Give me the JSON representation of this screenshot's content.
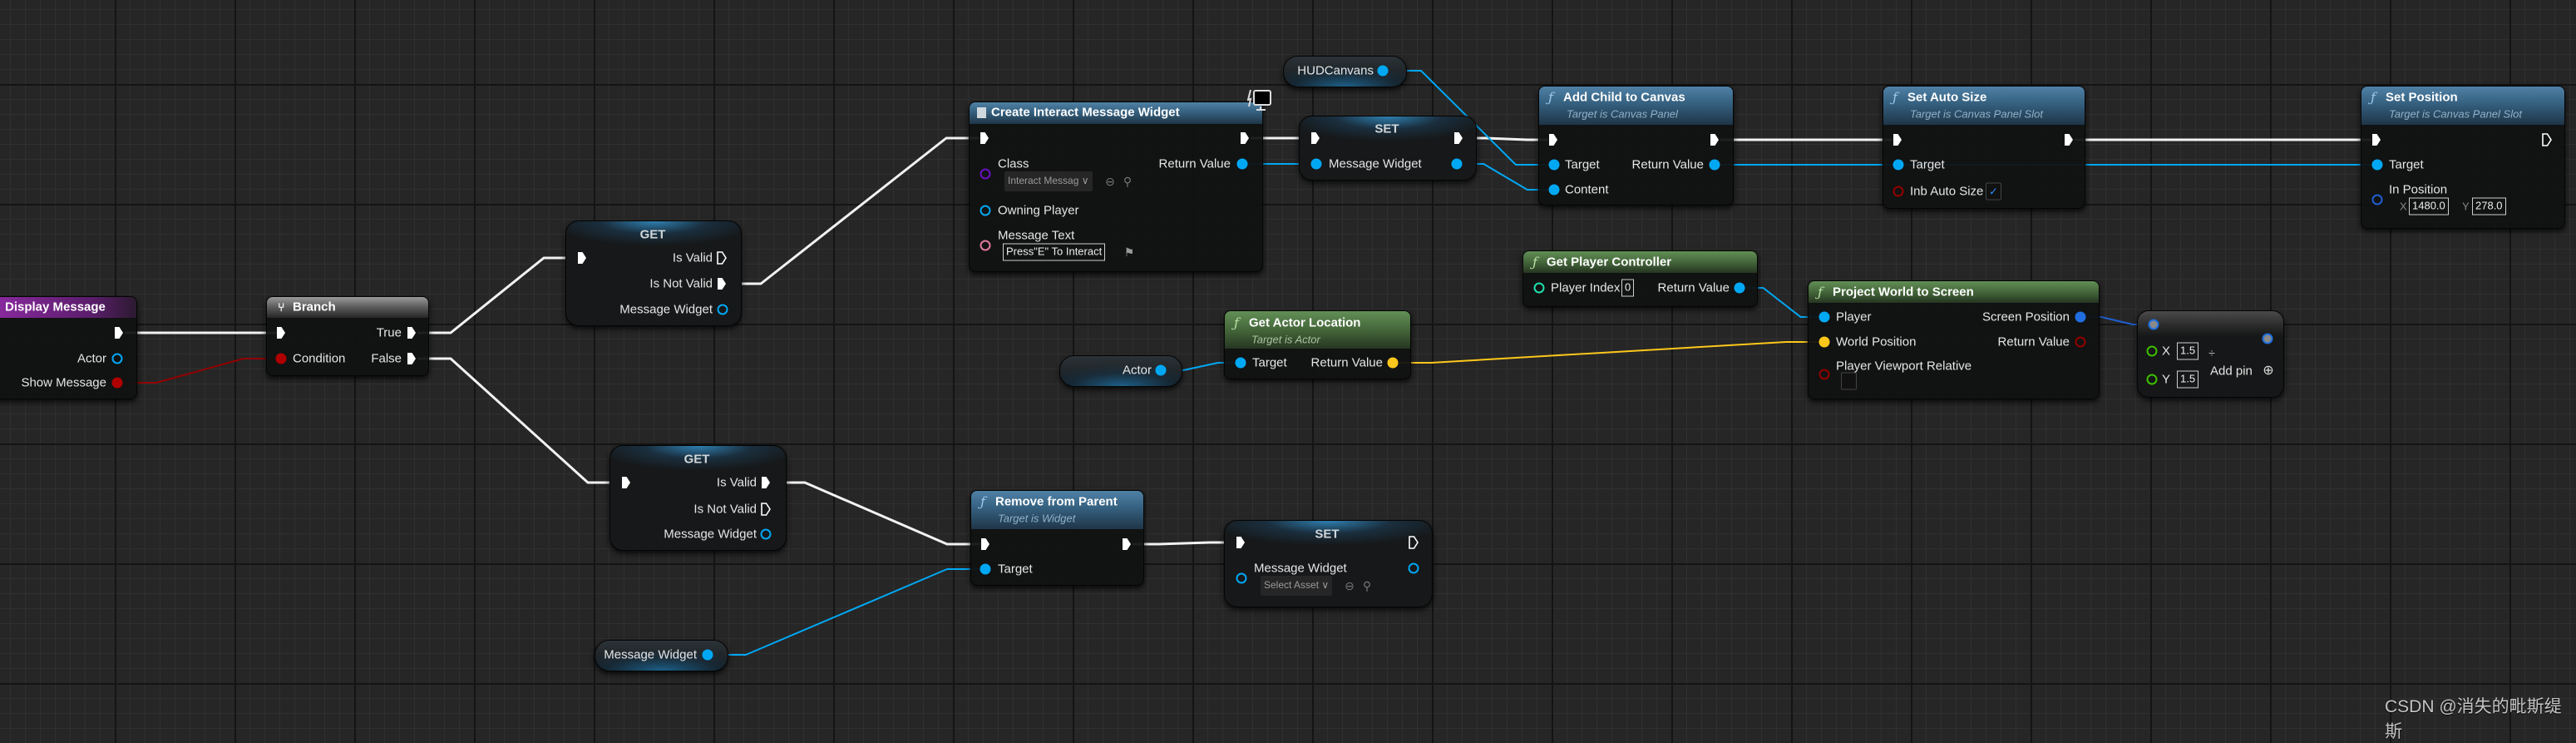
{
  "graph": {
    "display_message": {
      "title": "Display Message",
      "actor": "Actor",
      "show_message": "Show Message"
    },
    "branch": {
      "title": "Branch",
      "true": "True",
      "false": "False",
      "condition": "Condition"
    },
    "get_top": {
      "title": "GET",
      "is_valid": "Is Valid",
      "is_not_valid": "Is Not Valid",
      "message_widget": "Message Widget"
    },
    "get_bottom": {
      "title": "GET",
      "is_valid": "Is Valid",
      "is_not_valid": "Is Not Valid",
      "message_widget": "Message Widget"
    },
    "create_widget": {
      "title": "Create Interact Message Widget",
      "class_label": "Class",
      "class_value": "Interact Messag",
      "return_value": "Return Value",
      "owning_player": "Owning Player",
      "message_text_label": "Message Text",
      "message_text_value": "Press\"E\" To Interact"
    },
    "set_top": {
      "title": "SET",
      "message_widget": "Message Widget"
    },
    "hud_canvas": {
      "label": "HUDCanvans"
    },
    "add_child": {
      "title": "Add Child to Canvas",
      "subtitle": "Target is Canvas Panel",
      "target": "Target",
      "content": "Content",
      "return_value": "Return Value"
    },
    "set_auto_size": {
      "title": "Set Auto Size",
      "subtitle": "Target is Canvas Panel Slot",
      "target": "Target",
      "inb_auto_size": "Inb Auto Size",
      "checked": true
    },
    "set_position": {
      "title": "Set Position",
      "subtitle": "Target is Canvas Panel Slot",
      "target": "Target",
      "in_position": "In Position",
      "x_label": "X",
      "x_value": "1480.0",
      "y_label": "Y",
      "y_value": "278.0"
    },
    "get_player_controller": {
      "title": "Get Player Controller",
      "player_index": "Player Index",
      "player_index_value": "0",
      "return_value": "Return Value"
    },
    "get_actor_location": {
      "title": "Get Actor Location",
      "subtitle": "Target is Actor",
      "target": "Target",
      "return_value": "Return Value"
    },
    "actor_getter": {
      "label": "Actor"
    },
    "project_world_to_screen": {
      "title": "Project World to Screen",
      "player": "Player",
      "world_position": "World Position",
      "screen_position": "Screen Position",
      "return_value": "Return Value",
      "player_viewport_relative": "Player Viewport Relative",
      "checked": false
    },
    "multiply": {
      "x_label": "X",
      "x_value": "1.5",
      "y_label": "Y",
      "y_value": "1.5",
      "add_pin": "Add pin"
    },
    "remove_from_parent": {
      "title": "Remove from Parent",
      "subtitle": "Target is Widget",
      "target": "Target"
    },
    "set_bottom": {
      "title": "SET",
      "message_widget": "Message Widget",
      "select_asset": "Select Asset"
    },
    "message_widget_getter": {
      "label": "Message Widget"
    }
  },
  "watermark": "CSDN @消失的毗斯缇斯",
  "colors": {
    "exec": "#ffffff",
    "object": "#00a8f4",
    "bool": "#930000",
    "vector": "#fdc81b",
    "int": "#1fe0aa",
    "class": "#5a00a6",
    "text": "#e27a9d",
    "vector2d": "#1f5fd0",
    "float": "#3cc000",
    "canvas": "#262626"
  }
}
